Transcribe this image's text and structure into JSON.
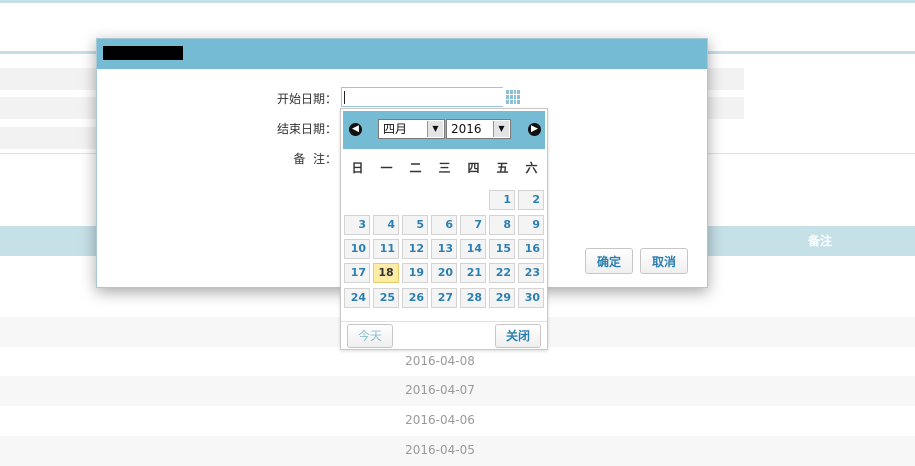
{
  "background": {
    "note_header": "备注",
    "rows": [
      "",
      "2016-04-08",
      "2016-04-07",
      "2016-04-06",
      "2016-04-05"
    ]
  },
  "dialog": {
    "start_label": "开始日期：",
    "end_label": "结束日期：",
    "note_label": "备  注：",
    "start_value": "",
    "confirm_label": "确定",
    "cancel_label": "取消"
  },
  "calendar": {
    "month": "四月",
    "year": "2016",
    "weekdays": [
      "日",
      "一",
      "二",
      "三",
      "四",
      "五",
      "六"
    ],
    "weeks": [
      [
        "",
        "",
        "",
        "",
        "",
        "1",
        "2"
      ],
      [
        "3",
        "4",
        "5",
        "6",
        "7",
        "8",
        "9"
      ],
      [
        "10",
        "11",
        "12",
        "13",
        "14",
        "15",
        "16"
      ],
      [
        "17",
        "18",
        "19",
        "20",
        "21",
        "22",
        "23"
      ],
      [
        "24",
        "25",
        "26",
        "27",
        "28",
        "29",
        "30"
      ]
    ],
    "today": "18",
    "today_label": "今天",
    "close_label": "关闭"
  },
  "colors": {
    "header": "#74bbd3",
    "accent_text": "#2c80b1",
    "today_bg": "#fdeca5"
  },
  "icons": [
    "calendar-icon",
    "prev-month-icon",
    "next-month-icon",
    "dropdown-arrow-icon"
  ]
}
